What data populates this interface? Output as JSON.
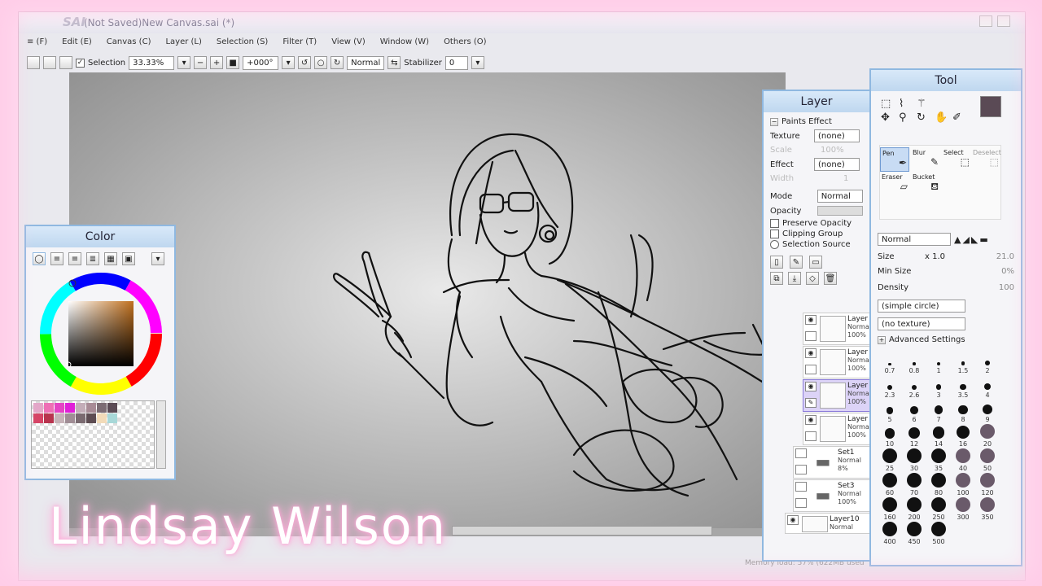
{
  "app": {
    "title": "(Not Saved)New Canvas.sai (*)",
    "logo": "SAI"
  },
  "menu": [
    "Edit (E)",
    "Canvas (C)",
    "Layer (L)",
    "Selection (S)",
    "Filter (T)",
    "View (V)",
    "Window (W)",
    "Others (O)"
  ],
  "toolbar": {
    "selection_label": "Selection",
    "zoom": "33.33%",
    "rotation": "+000°",
    "blend": "Normal",
    "stabilizer_label": "Stabilizer",
    "stabilizer_value": "0"
  },
  "color_panel": {
    "title": "Color",
    "wheel_hue_hex": "#c0701e",
    "swatches": [
      "#e3a7c8",
      "#ee6fb5",
      "#e543c4",
      "#e01fd8",
      "#c3adb8",
      "#a88b96",
      "#7c6c74",
      "#5b4b55",
      "#d64466",
      "#b8344e",
      "#c6b3b8",
      "#a08d95",
      "#7a6a70",
      "#5d4c52",
      "#f2dbb9",
      "#a8d8d8"
    ]
  },
  "layer_panel": {
    "title": "Layer",
    "paints_effect": "Paints Effect",
    "texture_label": "Texture",
    "texture_value": "(none)",
    "scale_label": "Scale",
    "scale_value": "100%",
    "effect_label": "Effect",
    "effect_value": "(none)",
    "width_label": "Width",
    "width_value": "1",
    "mode_label": "Mode",
    "mode_value": "Normal",
    "opacity_label": "Opacity",
    "preserve_opacity": "Preserve Opacity",
    "clipping_group": "Clipping Group",
    "selection_source": "Selection Source",
    "layers": [
      {
        "name": "Layer",
        "mode": "Normal",
        "opacity": "100%"
      },
      {
        "name": "Layer",
        "mode": "Normal",
        "opacity": "100%"
      },
      {
        "name": "Layer",
        "mode": "Normal",
        "opacity": "100%"
      },
      {
        "name": "Layer",
        "mode": "Normal",
        "opacity": "100%"
      },
      {
        "name": "Set1",
        "mode": "Normal",
        "opacity": "8%"
      },
      {
        "name": "Set3",
        "mode": "Normal",
        "opacity": "100%"
      },
      {
        "name": "Layer10",
        "mode": "Normal",
        "opacity": ""
      }
    ]
  },
  "tool_panel": {
    "title": "Tool",
    "tools": [
      "Pen",
      "Blur",
      "Select",
      "Deselect",
      "Eraser",
      "Bucket"
    ],
    "blend": "Normal",
    "size_label": "Size",
    "size_mult": "x 1.0",
    "size_value": "21.0",
    "min_size_label": "Min Size",
    "min_size_value": "0%",
    "density_label": "Density",
    "density_value": "100",
    "brush_shape": "(simple circle)",
    "brush_texture": "(no texture)",
    "advanced": "Advanced Settings",
    "brush_sizes": [
      "0.7",
      "0.8",
      "1",
      "1.5",
      "2",
      "2.3",
      "2.6",
      "3",
      "3.5",
      "4",
      "5",
      "6",
      "7",
      "8",
      "9",
      "10",
      "12",
      "14",
      "16",
      "20",
      "25",
      "30",
      "35",
      "40",
      "50",
      "60",
      "70",
      "80",
      "100",
      "120",
      "160",
      "200",
      "250",
      "300",
      "350",
      "400",
      "450",
      "500"
    ]
  },
  "status": {
    "memory": "Memory load: 57% (622MB used"
  },
  "overlay": {
    "signature": "Lindsay Wilson"
  }
}
